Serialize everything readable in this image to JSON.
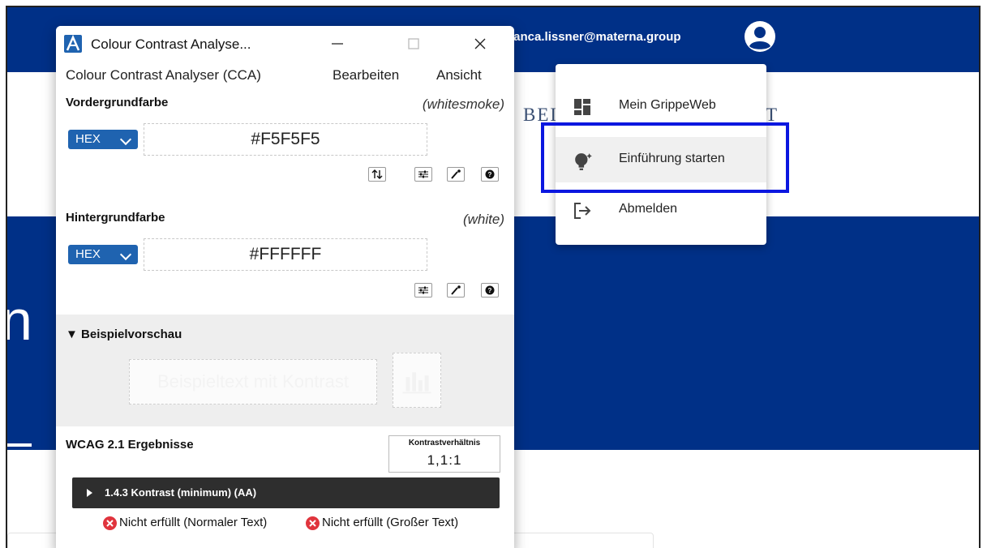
{
  "page": {
    "user_email": "ianca.lissner@materna.group",
    "logo_text_left": "BEI",
    "logo_text_right": "T",
    "hero_letter": "n"
  },
  "user_menu": {
    "items": [
      {
        "label": "Mein GrippeWeb",
        "icon": "dashboard-icon"
      },
      {
        "label": "Einführung starten",
        "icon": "lightbulb-icon"
      },
      {
        "label": "Abmelden",
        "icon": "logout-icon"
      }
    ],
    "highlight_color": "#0b17e0"
  },
  "cca": {
    "title": "Colour Contrast Analyse...",
    "menu": [
      "Colour Contrast Analyser (CCA)",
      "Bearbeiten",
      "Ansicht"
    ],
    "foreground": {
      "title": "Vordergrundfarbe",
      "color_name": "(whitesmoke)",
      "format": "HEX",
      "value": "#F5F5F5"
    },
    "background": {
      "title": "Hintergrundfarbe",
      "color_name": "(white)",
      "format": "HEX",
      "value": "#FFFFFF"
    },
    "preview": {
      "title": "▼ Beispielvorschau",
      "sample_text": "Beispieltext mit Kontrast"
    },
    "results": {
      "title": "WCAG 2.1 Ergebnisse",
      "ratio_label": "Kontrastverhältnis",
      "ratio_value": "1,1:1",
      "criterion": "1.4.3 Kontrast (minimum) (AA)",
      "normal_text_result": "Nicht erfüllt (Normaler Text)",
      "large_text_result": "Nicht erfüllt (Großer Text)"
    }
  },
  "colors": {
    "brand_blue": "#003087",
    "select_blue": "#1f63b0",
    "fail_red": "#e0343d"
  }
}
